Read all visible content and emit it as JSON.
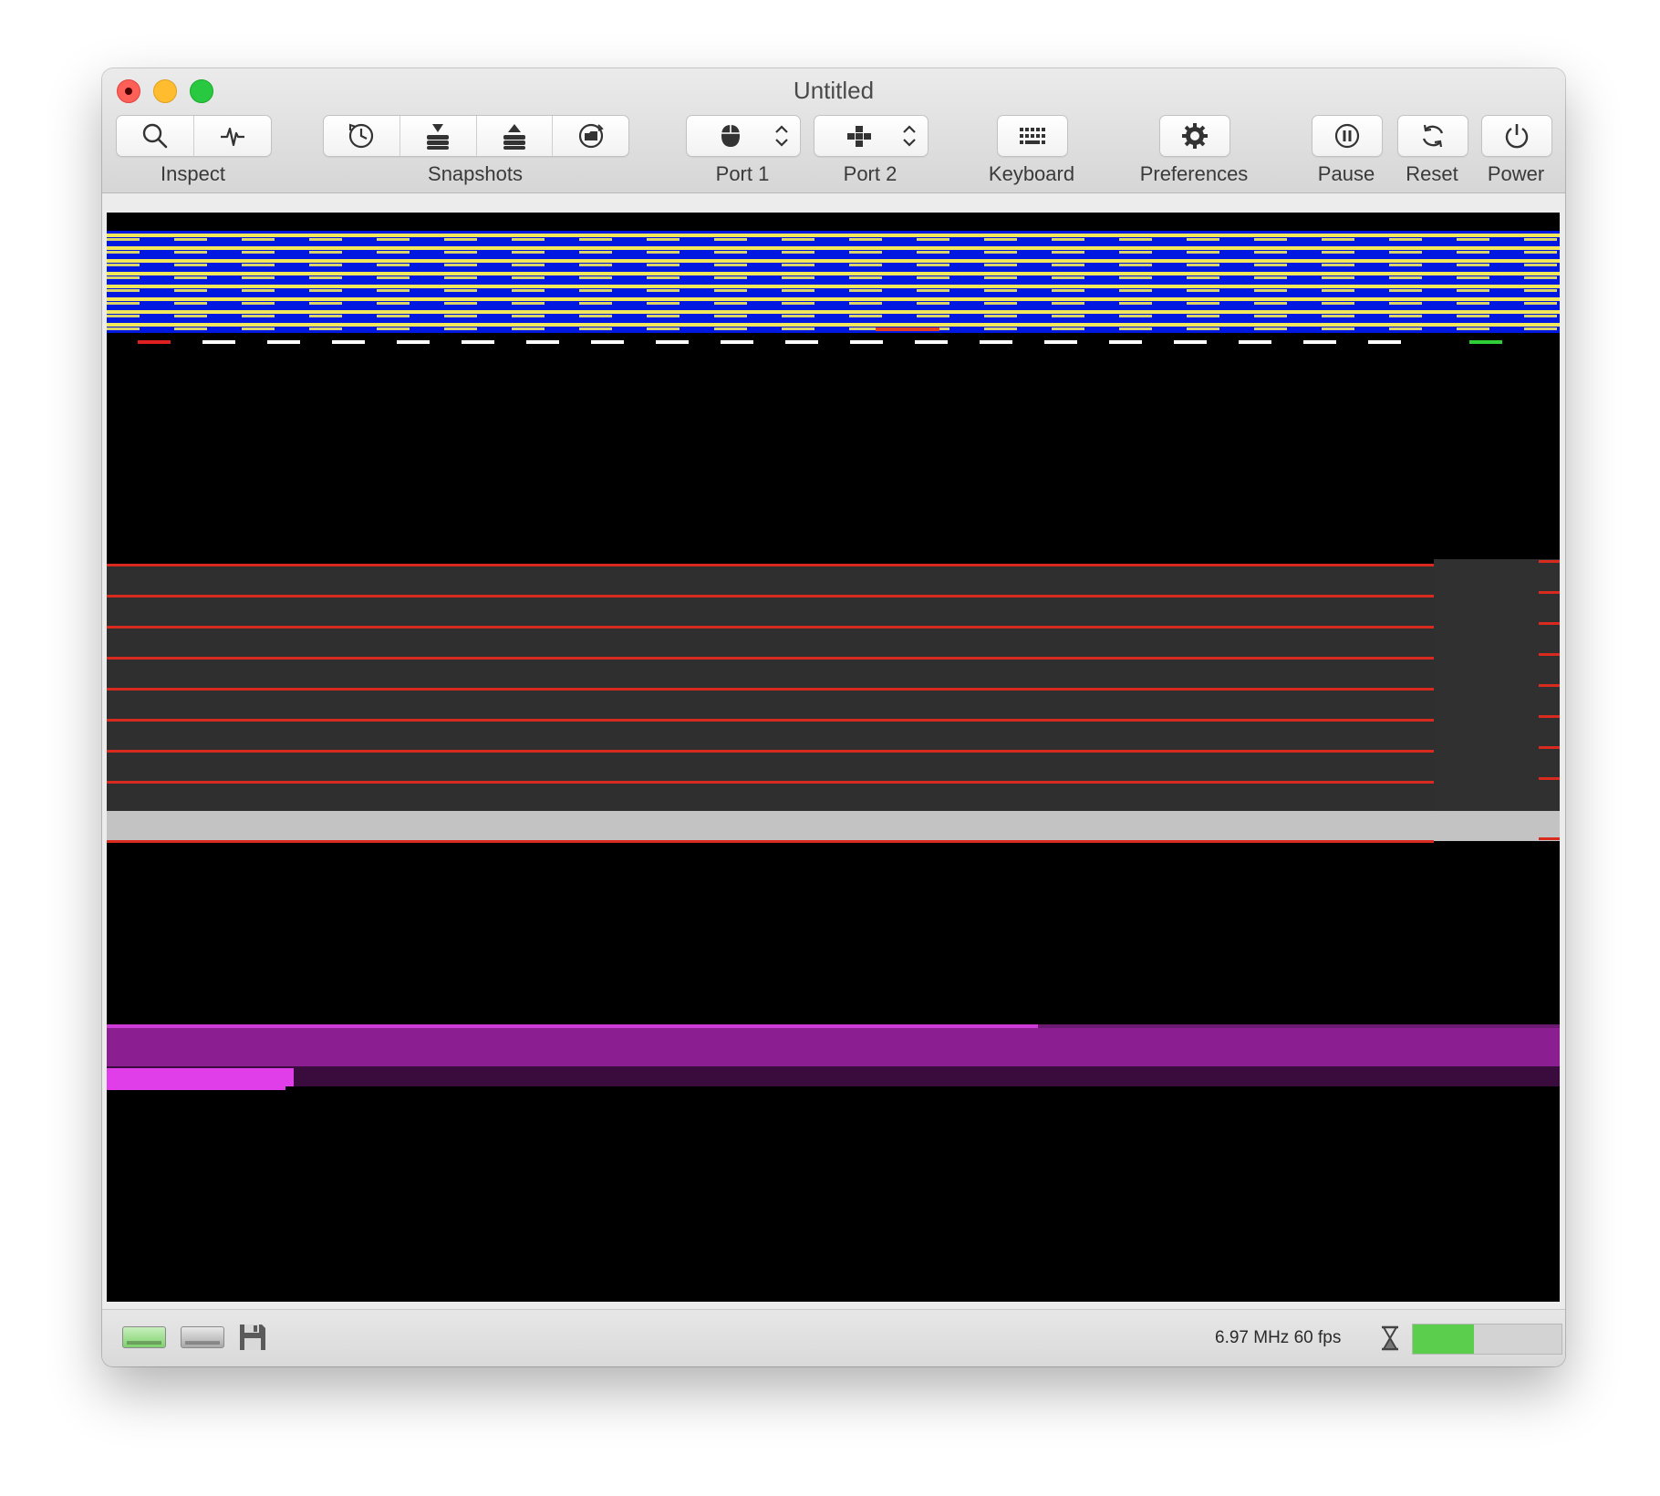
{
  "window": {
    "title": "Untitled"
  },
  "toolbar": {
    "inspect_label": "Inspect",
    "snapshots_label": "Snapshots",
    "port1_label": "Port 1",
    "port2_label": "Port 2",
    "keyboard_label": "Keyboard",
    "preferences_label": "Preferences",
    "pause_label": "Pause",
    "reset_label": "Reset",
    "power_label": "Power",
    "inspect_icons": [
      "magnifier-icon",
      "pulse-icon"
    ],
    "snapshot_icons": [
      "snapshot-clock-icon",
      "snapshot-stack-down-icon",
      "snapshot-stack-up-icon",
      "snapshot-browse-icon"
    ],
    "port1_icon": "mouse-icon",
    "port2_icon": "joystick-icon"
  },
  "screen": {
    "colors": {
      "stripe_blue": "#0018e0",
      "stripe_yellow": "#f2e85a",
      "raster_red": "#d92a1f",
      "band_gray": "#2f2f2f",
      "light_gray": "#c3c3c3",
      "purple": "#8b1f91",
      "magenta": "#e03ee8"
    }
  },
  "statusbar": {
    "speed_text": "6.97 MHz 60 fps",
    "drive_icons": [
      "drive-active-icon",
      "drive-idle-icon",
      "floppy-disk-icon"
    ],
    "gauge_fill_fraction": 0.41,
    "gauge_color": "#5bcf4d"
  }
}
